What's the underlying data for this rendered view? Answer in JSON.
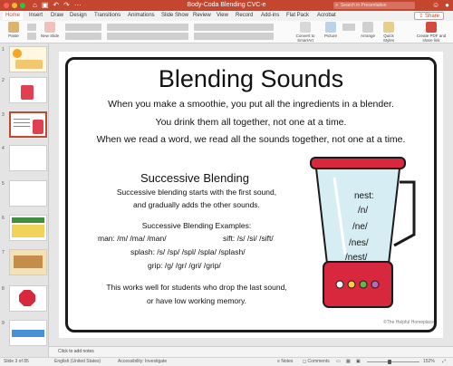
{
  "window": {
    "title": "Body-Coda Blending CVC-e",
    "search_placeholder": "Search in Presentation",
    "qa_icons": [
      "home-icon",
      "save-icon",
      "undo-icon",
      "redo-icon",
      "more-icon"
    ]
  },
  "tabs": [
    "Home",
    "Insert",
    "Draw",
    "Design",
    "Transitions",
    "Animations",
    "Slide Show",
    "Review",
    "View",
    "Record",
    "Add-ins",
    "Flat Pack",
    "Acrobat"
  ],
  "active_tab": "Home",
  "share_label": "Share",
  "ribbon": {
    "paste": "Paste",
    "new_slide": "New Slide",
    "convert": "Convert to SmartArt",
    "picture": "Picture",
    "arrange": "Arrange",
    "quick_styles": "Quick Styles",
    "create_pdf": "Create PDF and share link"
  },
  "thumbnails": [
    "1",
    "2",
    "3",
    "4",
    "5",
    "6",
    "7",
    "8",
    "9"
  ],
  "slide": {
    "title": "Blending Sounds",
    "intro": [
      "When you make a smoothie, you put all the ingredients in a blender.",
      "You drink them all together, not one at a time.",
      "When we read a word, we read all the sounds together, not one at a time."
    ],
    "subtitle": "Successive Blending",
    "desc": [
      "Successive blending starts with the first sound,",
      "and gradually adds the other sounds."
    ],
    "examples_heading": "Successive Blending Examples:",
    "examples": [
      "man: /m/ /ma/ /man/",
      "sift: /s/ /si/ /sift/",
      "splash:  /s/ /sp/ /spl/ /spla/ /splash/",
      "grip: /g/ /gr/ /gri/ /grip/"
    ],
    "closing": [
      "This works well for students who drop the last sound,",
      "or have low working memory."
    ],
    "blender_words": [
      "nest:",
      "/n/",
      "/ne/",
      "/nes/",
      "/nest/"
    ],
    "credit": "©The Helpful Homeplace"
  },
  "notes_placeholder": "Click to add notes",
  "status": {
    "slide": "Slide 3 of 85",
    "language": "English (United States)",
    "accessibility": "Accessibility: Investigate",
    "notes": "Notes",
    "comments": "Comments",
    "zoom": "152%"
  },
  "colors": {
    "accent": "#c4462f",
    "blender_red": "#d8283e",
    "blender_glass": "#d6eef3",
    "frame": "#1b1b1b"
  }
}
